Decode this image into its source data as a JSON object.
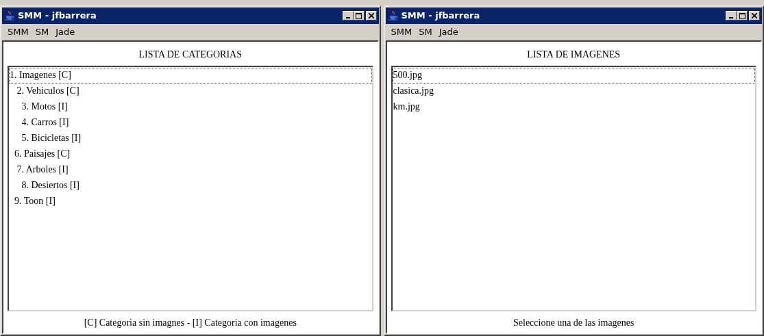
{
  "windows": [
    {
      "title": "SMM - jfbarrera",
      "menu": [
        "SMM",
        "SM",
        "Jade"
      ],
      "heading": "LISTA DE CATEGORIAS",
      "items": [
        {
          "text": "1. Imagenes [C]",
          "focused": true
        },
        {
          "text": "   2. Vehiculos [C]",
          "focused": false
        },
        {
          "text": "     3. Motos [I]",
          "focused": false
        },
        {
          "text": "     4. Carros [I]",
          "focused": false
        },
        {
          "text": "     5. Bicicletas [I]",
          "focused": false
        },
        {
          "text": "  6. Paisajes [C]",
          "focused": false
        },
        {
          "text": "   7. Arboles [I]",
          "focused": false
        },
        {
          "text": "     8. Desiertos [I]",
          "focused": false
        },
        {
          "text": "  9. Toon [I]",
          "focused": false
        }
      ],
      "footer": "[C] Categoria sin imagnes - [I] Categoria con imagenes"
    },
    {
      "title": "SMM - jfbarrera",
      "menu": [
        "SMM",
        "SM",
        "Jade"
      ],
      "heading": "LISTA DE IMAGENES",
      "items": [
        {
          "text": "500.jpg",
          "focused": true
        },
        {
          "text": "clasica.jpg",
          "focused": false
        },
        {
          "text": "km.jpg",
          "focused": false
        }
      ],
      "footer": "Seleccione una de las imagenes"
    }
  ]
}
